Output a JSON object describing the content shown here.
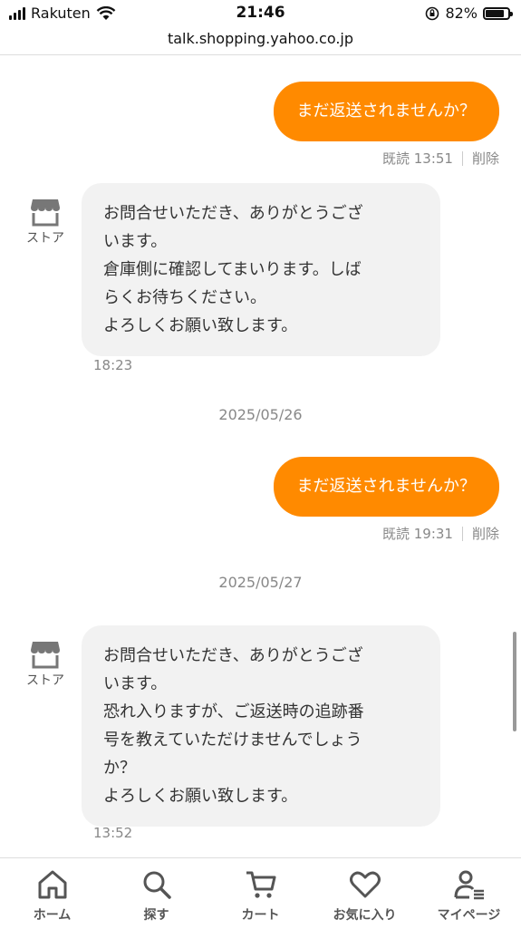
{
  "status_bar": {
    "carrier": "Rakuten",
    "time": "21:46",
    "battery": "82%",
    "battery_level": 0.82
  },
  "url": "talk.shopping.yahoo.co.jp",
  "chat": {
    "messages": [
      {
        "text": "まだ返送されませんか？",
        "read": "既読 13:51",
        "delete": "削除"
      },
      {
        "sender": "ストア",
        "text": "お問合せいただき、ありがとうござ\nいます。\n倉庫側に確認してまいります。しば\nらくお待ちください。\nよろしくお願い致します。",
        "time": "18:23"
      },
      {
        "date": "2025/05/26"
      },
      {
        "text": "まだ返送されませんか？",
        "read": "既読 19:31",
        "delete": "削除"
      },
      {
        "date": "2025/05/27"
      },
      {
        "sender": "ストア",
        "text": "お問合せいただき、ありがとうござ\nいます。\n恐れ入りますが、ご返送時の追跡番\n号を教えていただけませんでしょう\nか？\nよろしくお願い致します。",
        "time": "13:52"
      }
    ]
  },
  "bottom_nav": {
    "items": [
      {
        "label": "ホーム",
        "icon": "home-icon"
      },
      {
        "label": "探す",
        "icon": "search-icon"
      },
      {
        "label": "カート",
        "icon": "cart-icon"
      },
      {
        "label": "お気に入り",
        "icon": "heart-icon"
      },
      {
        "label": "マイページ",
        "icon": "user-icon"
      }
    ]
  },
  "colors": {
    "accent": "#ff8a00",
    "bubble_in": "#f2f2f2"
  }
}
